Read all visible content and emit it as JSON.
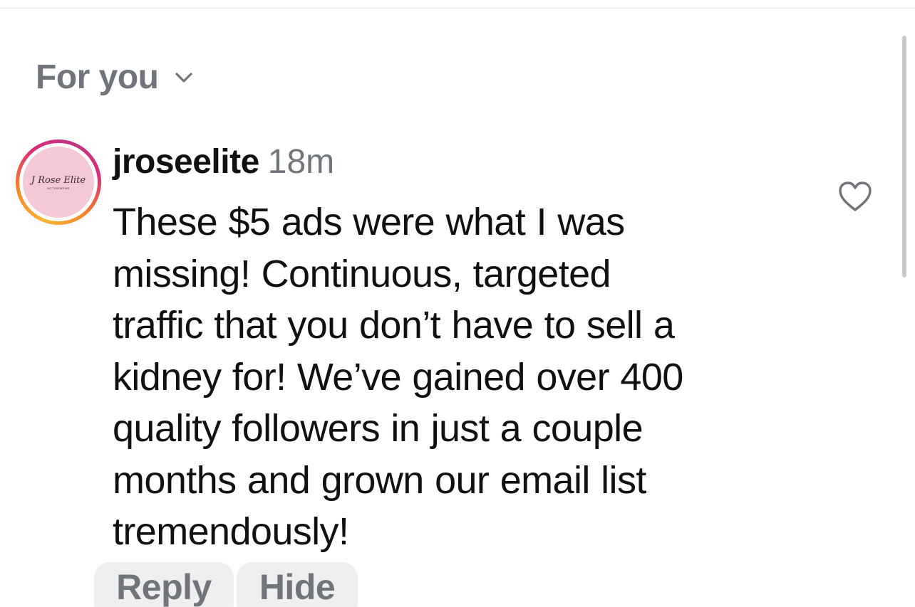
{
  "sort": {
    "label": "For you",
    "icon": "chevron-down-icon"
  },
  "comment": {
    "username": "jroseelite",
    "time": "18m",
    "avatar": {
      "brand_text": "J Rose Elite",
      "sub_text": "ACTIVEWEAR"
    },
    "text": "These $5 ads were what I was\nmissing! Continuous, targeted\ntraffic that you don’t have to sell a\nkidney for! We’ve gained over 400\nquality followers in just a couple\nmonths and grown our email list\ntremendously!",
    "like_icon": "heart-outline-icon",
    "actions": {
      "reply_label": "Reply",
      "hide_label": "Hide"
    }
  },
  "colors": {
    "text_primary": "#111111",
    "text_secondary": "#70757c",
    "pill_bg": "#efefef",
    "avatar_bg": "#f5c8d6"
  }
}
